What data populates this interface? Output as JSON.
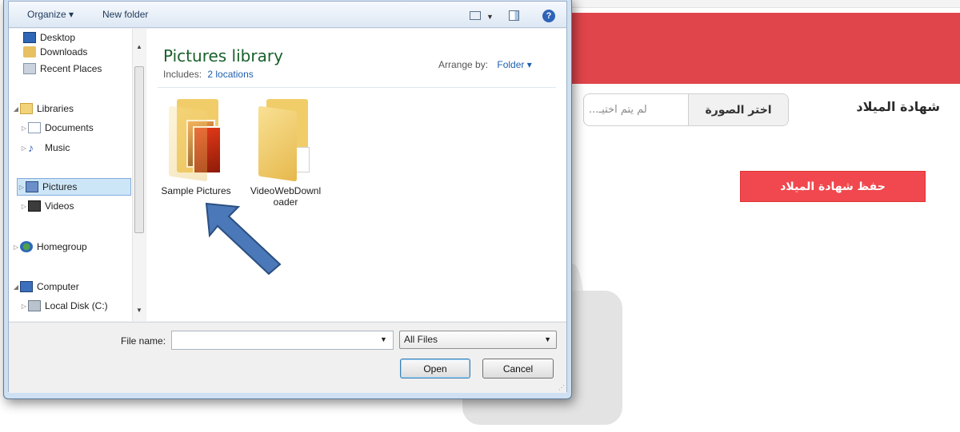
{
  "page": {
    "title": "شهادة الميلاد",
    "choose_image_button": "اختر الصورة",
    "file_status": "لم يتم اختيـ...",
    "save_button": "حفظ شهادة الميلاد",
    "colors": {
      "banner": "#e0454b",
      "save_button": "#f0484e"
    }
  },
  "dialog": {
    "toolbar": {
      "organize": "Organize ▾",
      "new_folder": "New folder"
    },
    "nav": {
      "desktop": "Desktop",
      "downloads": "Downloads",
      "recent_places": "Recent Places",
      "libraries": "Libraries",
      "documents": "Documents",
      "music": "Music",
      "pictures": "Pictures",
      "videos": "Videos",
      "homegroup": "Homegroup",
      "computer": "Computer",
      "local_disk": "Local Disk (C:)"
    },
    "library": {
      "title": "Pictures library",
      "includes_label": "Includes:",
      "includes_link": "2 locations",
      "arrange_label": "Arrange by:",
      "arrange_value": "Folder ▾"
    },
    "folders": {
      "sample_pictures": "Sample Pictures",
      "video_downloader_line1": "VideoWebDownl",
      "video_downloader_line2": "oader"
    },
    "bottom": {
      "file_name_label": "File name:",
      "file_name_value": "",
      "file_type": "All Files",
      "open": "Open",
      "cancel": "Cancel"
    }
  }
}
